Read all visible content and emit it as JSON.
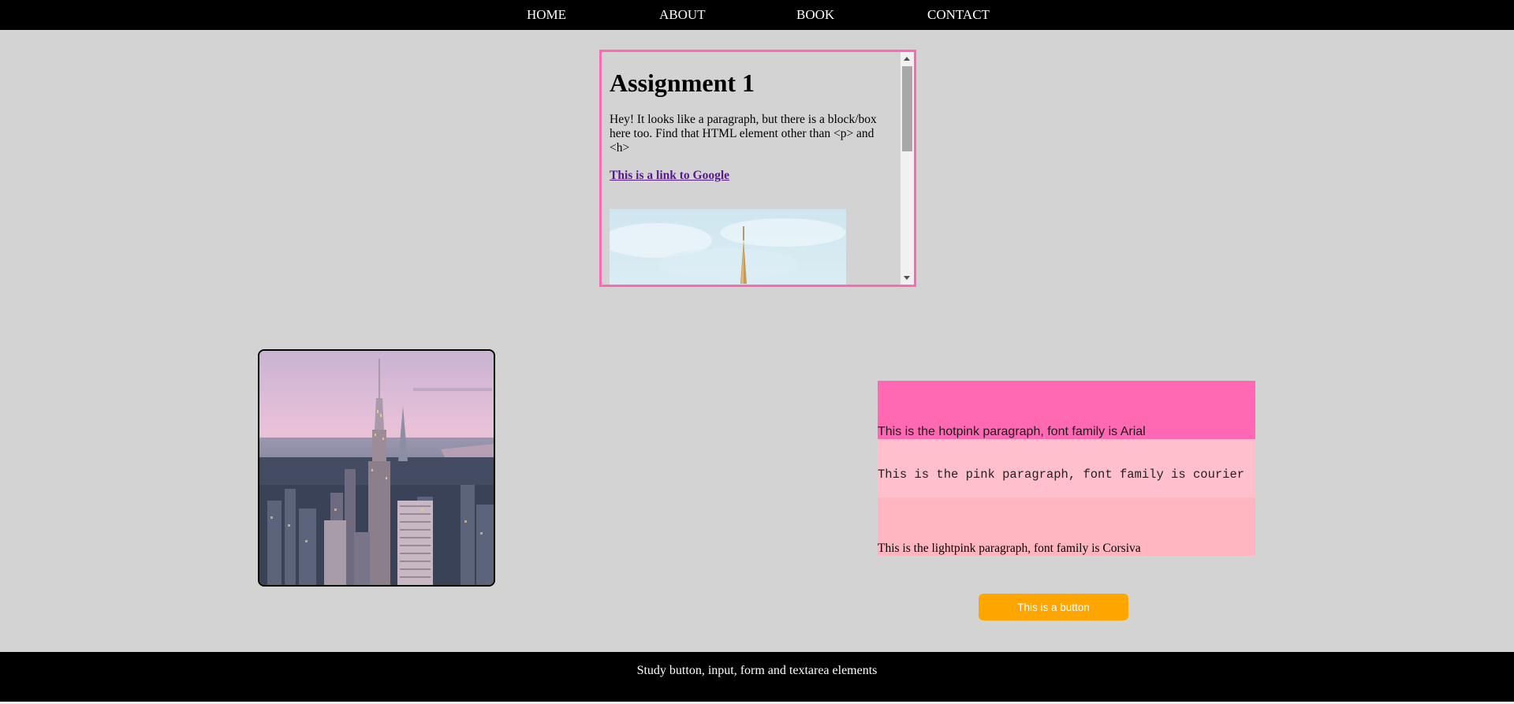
{
  "nav": {
    "items": [
      {
        "label": "HOME"
      },
      {
        "label": "ABOUT"
      },
      {
        "label": "BOOK"
      },
      {
        "label": "CONTACT"
      }
    ]
  },
  "scrollbox": {
    "title": "Assignment 1",
    "body": "Hey! It looks like a paragraph, but there is a block/box here too. Find that HTML element other than <p> and <h>",
    "link_text": "This is a link to Google"
  },
  "paragraphs": {
    "hotpink": "This is the hotpink paragraph, font family is Arial",
    "pink": "This is the pink paragraph, font family is courier",
    "lightpink": "This is the lightpink paragraph, font family is Corsiva"
  },
  "button": {
    "label": "This is a button"
  },
  "footer": {
    "text": "Study button, input, form and textarea elements"
  },
  "colors": {
    "nav_bg": "#000000",
    "page_bg": "#d3d3d3",
    "scrollbox_border": "#ff69b4",
    "hotpink": "#ff69b4",
    "pink": "#ffc0cb",
    "lightpink": "#ffb6c1",
    "button_bg": "#ffa500",
    "link": "#551a8b"
  }
}
